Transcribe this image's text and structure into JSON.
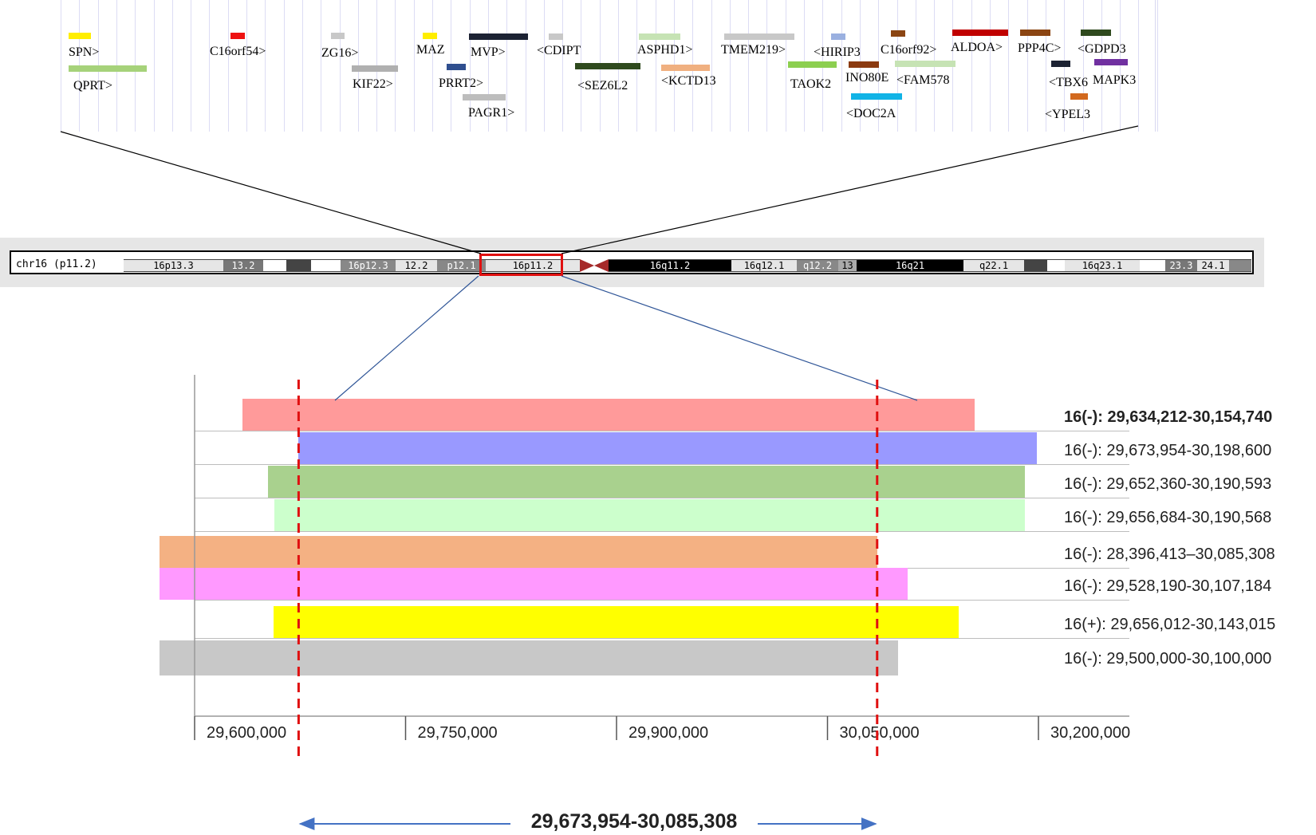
{
  "gene_track": {
    "genes": [
      {
        "name": "SPN>",
        "color": "#ffee00"
      },
      {
        "name": "QPRT>",
        "color": "#a6d27a"
      },
      {
        "name": "C16orf54>",
        "color": "#ee1111"
      },
      {
        "name": "ZG16>",
        "color": "#c8c8c8"
      },
      {
        "name": "KIF22>",
        "color": "#b0b0b0"
      },
      {
        "name": "MAZ",
        "color": "#ffee00"
      },
      {
        "name": "PRRT2>",
        "color": "#2f4f8f"
      },
      {
        "name": "PAGR1>",
        "color": "#bdbdbd"
      },
      {
        "name": "MVP>",
        "color": "#1c2233"
      },
      {
        "name": "<CDIPT",
        "color": "#c8c8c8"
      },
      {
        "name": "<SEZ6L2",
        "color": "#2f4a1e"
      },
      {
        "name": "ASPHD1>",
        "color": "#c6e3b4"
      },
      {
        "name": "<KCTD13",
        "color": "#f0b080"
      },
      {
        "name": "TMEM219>",
        "color": "#c8c8c8"
      },
      {
        "name": "TAOK2",
        "color": "#8ccf50"
      },
      {
        "name": "<HIRIP3",
        "color": "#9ab0e0"
      },
      {
        "name": "INO80E",
        "color": "#8b3a10"
      },
      {
        "name": "<DOC2A",
        "color": "#11b3e6"
      },
      {
        "name": "C16orf92>",
        "color": "#8b4513"
      },
      {
        "name": "<FAM578",
        "color": "#c6e3b4"
      },
      {
        "name": "ALDOA>",
        "color": "#c00000"
      },
      {
        "name": "PPP4C>",
        "color": "#8b4513"
      },
      {
        "name": "<TBX6",
        "color": "#1c2233"
      },
      {
        "name": "<YPEL3",
        "color": "#d2691e"
      },
      {
        "name": "<GDPD3",
        "color": "#2f4a1e"
      },
      {
        "name": "MAPK3",
        "color": "#7030a0"
      }
    ]
  },
  "ideogram": {
    "chromosome_label": "chr16 (p11.2)",
    "highlight_color": "#e01010",
    "bands": [
      {
        "name": "16p13.3",
        "shade": "#e6e6e6"
      },
      {
        "name": "13.2",
        "shade": "#777777"
      },
      {
        "name": "",
        "shade": "#ffffff"
      },
      {
        "name": "",
        "shade": "#444444"
      },
      {
        "name": "",
        "shade": "#ffffff"
      },
      {
        "name": "16p12.3",
        "shade": "#888888"
      },
      {
        "name": "12.2",
        "shade": "#e6e6e6"
      },
      {
        "name": "p12.1",
        "shade": "#888888"
      },
      {
        "name": "16p11.2",
        "shade": "#e6e6e6"
      },
      {
        "name": "16q11.2",
        "shade": "#000000"
      },
      {
        "name": "16q12.1",
        "shade": "#e6e6e6"
      },
      {
        "name": "q12.2",
        "shade": "#888888"
      },
      {
        "name": "13",
        "shade": "#aaaaaa"
      },
      {
        "name": "16q21",
        "shade": "#000000"
      },
      {
        "name": "q22.1",
        "shade": "#e6e6e6"
      },
      {
        "name": "",
        "shade": "#444444"
      },
      {
        "name": "",
        "shade": "#ffffff"
      },
      {
        "name": "16q23.1",
        "shade": "#e6e6e6"
      },
      {
        "name": "",
        "shade": "#ffffff"
      },
      {
        "name": "23.3",
        "shade": "#777777"
      },
      {
        "name": "24.1",
        "shade": "#e6e6e6"
      },
      {
        "name": "",
        "shade": "#888888"
      }
    ]
  },
  "chart_data": {
    "type": "bar",
    "orientation": "horizontal",
    "x_ticks": [
      29600000,
      29750000,
      29900000,
      30050000,
      30200000
    ],
    "x_tick_labels": [
      "29,600,000",
      "29,750,000",
      "29,900,000",
      "30,050,000",
      "30,200,000"
    ],
    "cnvs": [
      {
        "label": "16(-): 29,634,212-30,154,740",
        "start": 29634212,
        "end": 30154740,
        "color": "#ff9a9a",
        "bold": true
      },
      {
        "label": "16(-): 29,673,954-30,198,600",
        "start": 29673954,
        "end": 30198600,
        "color": "#9999ff",
        "bold": false
      },
      {
        "label": "16(-): 29,652,360-30,190,593",
        "start": 29652360,
        "end": 30190593,
        "color": "#a9d18e",
        "bold": false
      },
      {
        "label": "16(-): 29,656,684-30,190,568",
        "start": 29656684,
        "end": 30190568,
        "color": "#ccffcc",
        "bold": false
      },
      {
        "label": "16(-): 28,396,413–30,085,308",
        "start": 29510000,
        "end": 30085308,
        "color": "#f4b183",
        "bold": false
      },
      {
        "label": "16(-): 29,528,190-30,107,184",
        "start": 29528190,
        "end": 30107184,
        "color": "#ff99ff",
        "bold": false
      },
      {
        "label": "16(+): 29,656,012-30,143,015",
        "start": 29656012,
        "end": 30143015,
        "color": "#ffff00",
        "bold": false
      },
      {
        "label": "16(-): 29,500,000-30,100,000",
        "start": 29500000,
        "end": 30100000,
        "color": "#c8c8c8",
        "bold": false
      }
    ],
    "overlap": {
      "start": 29673954,
      "end": 30085308,
      "label": "29,673,954-30,085,308"
    },
    "dashed_line_color": "#e01010",
    "arrow_color": "#4472c4"
  }
}
